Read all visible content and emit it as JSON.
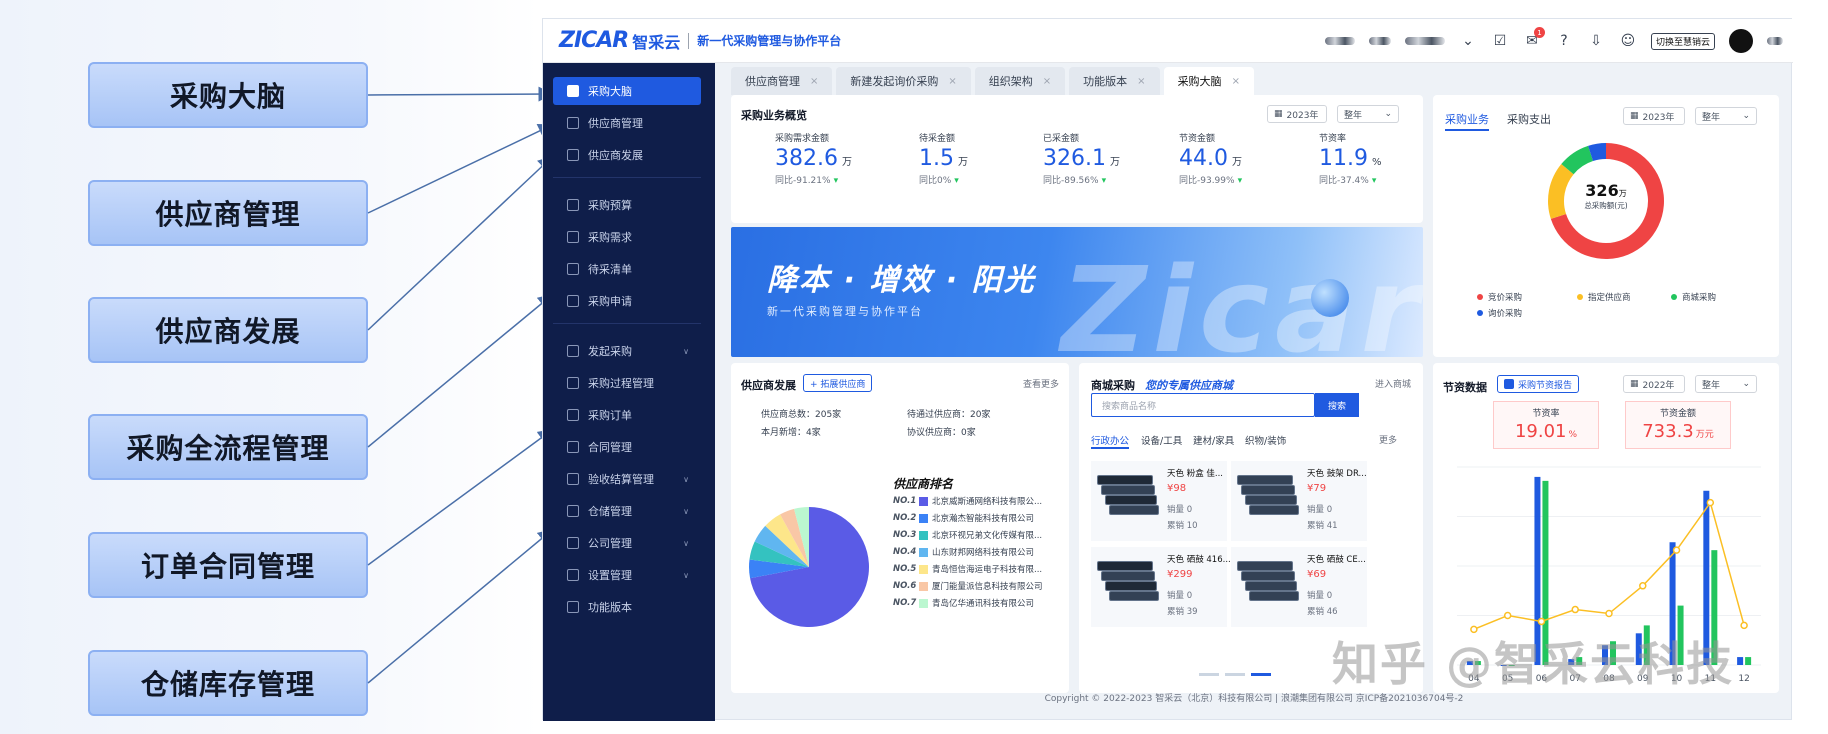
{
  "callouts": [
    "采购大脑",
    "供应商管理",
    "供应商发展",
    "采购全流程管理",
    "订单合同管理",
    "仓储库存管理"
  ],
  "brand": {
    "logo": "ZICAR",
    "name": "智采云",
    "slogan": "新一代采购管理与协作平台"
  },
  "topbar": {
    "switch_label": "切换至慧销云",
    "badge": "1"
  },
  "sidebar": {
    "items": [
      {
        "label": "采购大脑",
        "icon": "dashboard-icon",
        "active": true
      },
      {
        "label": "供应商管理",
        "icon": "supplier-icon"
      },
      {
        "label": "供应商发展",
        "icon": "supplier-growth-icon"
      },
      {
        "label": "采购预算",
        "icon": "budget-icon"
      },
      {
        "label": "采购需求",
        "icon": "demand-icon"
      },
      {
        "label": "待采清单",
        "icon": "list-icon"
      },
      {
        "label": "采购申请",
        "icon": "request-icon"
      },
      {
        "label": "发起采购",
        "icon": "cart-icon",
        "expand": true
      },
      {
        "label": "采购过程管理",
        "icon": "process-icon"
      },
      {
        "label": "采购订单",
        "icon": "order-icon"
      },
      {
        "label": "合同管理",
        "icon": "contract-icon"
      },
      {
        "label": "验收结算管理",
        "icon": "settlement-icon",
        "expand": true
      },
      {
        "label": "仓储管理",
        "icon": "warehouse-icon",
        "expand": true
      },
      {
        "label": "公司管理",
        "icon": "company-icon",
        "expand": true
      },
      {
        "label": "设置管理",
        "icon": "settings-icon",
        "expand": true
      },
      {
        "label": "功能版本",
        "icon": "version-icon"
      }
    ]
  },
  "tabs": [
    "供应商管理",
    "新建发起询价采购",
    "组织架构",
    "功能版本",
    "采购大脑"
  ],
  "overview": {
    "title": "采购业务概览",
    "year": "2023年",
    "period": "整年",
    "kpis": [
      {
        "label": "采购需求金额",
        "value": "382.6",
        "unit": "万",
        "change": "同比-91.21%"
      },
      {
        "label": "待采金额",
        "value": "1.5",
        "unit": "万",
        "change": "同比0%"
      },
      {
        "label": "已采金额",
        "value": "326.1",
        "unit": "万",
        "change": "同比-89.56%"
      },
      {
        "label": "节资金额",
        "value": "44.0",
        "unit": "万",
        "change": "同比-93.99%"
      },
      {
        "label": "节资率",
        "value": "11.9",
        "unit": "%",
        "change": "同比-37.4%"
      }
    ]
  },
  "banner": {
    "title": "降本 · 增效 · 阳光",
    "subtitle": "新一代采购管理与协作平台",
    "art": "Zicar"
  },
  "spend": {
    "tab1": "采购业务",
    "tab2": "采购支出",
    "year": "2023年",
    "period": "整年",
    "center_value": "326",
    "center_unit": "万",
    "center_label": "总采购额(元)",
    "legend": [
      {
        "name": "竞价采购",
        "color": "#ef4444"
      },
      {
        "name": "指定供应商",
        "color": "#fbbf24"
      },
      {
        "name": "商城采购",
        "color": "#22c55e"
      },
      {
        "name": "询价采购",
        "color": "#1f5ae0"
      }
    ],
    "donut": [
      0.7,
      0.16,
      0.09,
      0.05
    ]
  },
  "supplier": {
    "title": "供应商发展",
    "expand_btn": "+ 拓展供应商",
    "more": "查看更多",
    "stats": [
      "供应商总数：205家",
      "待通过供应商：20家",
      "本月新增：4家",
      "协议供应商：0家"
    ],
    "rank_title": "供应商排名",
    "ranks": [
      {
        "no": "NO.1",
        "name": "北京威斯通网络科技有限公...",
        "color": "#5a5be6"
      },
      {
        "no": "NO.2",
        "name": "北京瀚杰智能科技有限公司",
        "color": "#3b82f6"
      },
      {
        "no": "NO.3",
        "name": "北京环视兄弟文化传媒有限...",
        "color": "#34c2c0"
      },
      {
        "no": "NO.4",
        "name": "山东财邦网络科技有限公司",
        "color": "#60b6f0"
      },
      {
        "no": "NO.5",
        "name": "青岛恒信海运电子科技有限...",
        "color": "#fde68a"
      },
      {
        "no": "NO.6",
        "name": "厦门能量派信息科技有限公司",
        "color": "#f9c7a6"
      },
      {
        "no": "NO.7",
        "name": "青岛亿华通讯科技有限公司",
        "color": "#bbf7d0"
      }
    ],
    "pie": [
      0.72,
      0.05,
      0.05,
      0.05,
      0.05,
      0.04,
      0.04
    ]
  },
  "mall": {
    "title": "商城采购",
    "subtitle": "您的专属供应商城",
    "enter": "进入商城",
    "search_placeholder": "搜索商品名称",
    "search_btn": "搜索",
    "cats": [
      "行政办公",
      "设备/工具",
      "建材/家具",
      "织物/装饰"
    ],
    "more": "更多",
    "products": [
      {
        "title": "天色 粉盒 佳...",
        "price": "¥98",
        "sales": "销量 0",
        "total": "累销 10"
      },
      {
        "title": "天色 鼓架 DR...",
        "price": "¥79",
        "sales": "销量 0",
        "total": "累销 41"
      },
      {
        "title": "天色 硒鼓 416...",
        "price": "¥299",
        "sales": "销量 0",
        "total": "累销 39"
      },
      {
        "title": "天色 硒鼓 CE...",
        "price": "¥69",
        "sales": "销量 0",
        "total": "累销 46"
      }
    ]
  },
  "savings": {
    "title": "节资数据",
    "report_btn": "采购节资报告",
    "year": "2022年",
    "period": "整年",
    "rate_label": "节资率",
    "rate_value": "19.01",
    "rate_unit": "%",
    "amount_label": "节资金额",
    "amount_value": "733.3",
    "amount_unit": "万元"
  },
  "chart_data": {
    "type": "bar",
    "categories": [
      "04",
      "05",
      "06",
      "07",
      "08",
      "09",
      "10",
      "11",
      "12"
    ],
    "series": [
      {
        "values": [
          2,
          0,
          95,
          3,
          10,
          16,
          62,
          88,
          4
        ],
        "color": "#1f5ae0"
      },
      {
        "values": [
          2,
          0,
          93,
          4,
          12,
          20,
          30,
          58,
          4
        ],
        "color": "#22c55e"
      },
      {
        "values": [
          18,
          25,
          22,
          28,
          26,
          40,
          58,
          82,
          20
        ],
        "color": "#fbbf24",
        "kind": "line"
      }
    ],
    "ylim": [
      0,
      100
    ]
  },
  "footer": "Copyright © 2022-2023 智采云（北京）科技有限公司 | 浪潮集团有限公司 京ICP备2021036704号-2",
  "watermark": "知乎 @智采云科技"
}
